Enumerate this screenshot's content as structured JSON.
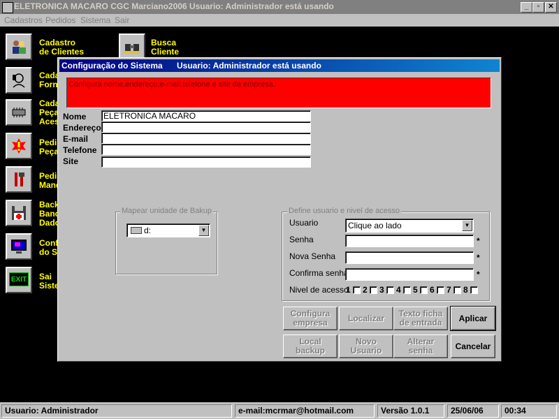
{
  "window": {
    "title": "ELETRONICA MACARO    CGC Marciano2006    Usuario: Administrador  está usando",
    "minimize_glyph": "_",
    "restore_glyph": "▫",
    "close_glyph": "✕"
  },
  "menu": [
    "Cadastros",
    "Pedidos",
    "Sistema",
    "Sair"
  ],
  "desktop_icons": [
    {
      "label": "Cadastro\nde Clientes",
      "icon": "people-icon"
    },
    {
      "label": "Busca\nCliente",
      "icon": "binoculars-icon"
    },
    {
      "label": "Cada\nForn",
      "icon": "phone-person-icon"
    },
    {
      "label": "Cada\nPeça\nAces",
      "icon": "chip-icon"
    },
    {
      "label": "Pedi\nPeça",
      "icon": "alert-icon"
    },
    {
      "label": "Pedi\nMand",
      "icon": "tools-icon"
    },
    {
      "label": "Back\nBanc\nDado",
      "icon": "floppy-icon"
    },
    {
      "label": "Conf\ndo S",
      "icon": "monitor-icon"
    },
    {
      "label": "Sai\nSiste",
      "icon": "exit-icon"
    }
  ],
  "exit_icon_text": "EXIT",
  "dialog": {
    "title": "Configuração do Sistema",
    "title_user": "Usuario: Administrador  está usando",
    "info_text": "Configura  nome,endereço,e-mail,telefone e site da empresa.",
    "fields": [
      {
        "label": "Nome",
        "value": "ELETRONICA MACARO"
      },
      {
        "label": "Endereço",
        "value": ""
      },
      {
        "label": "E-mail",
        "value": ""
      },
      {
        "label": "Telefone",
        "value": ""
      },
      {
        "label": "Site",
        "value": ""
      }
    ],
    "backup_group": {
      "title": "Mapear unidade de Bakup",
      "drive_value": "d:"
    },
    "user_group": {
      "title": "Define usuario e nivel de acesso",
      "usuario_label": "Usuario",
      "usuario_value": "Clique ao lado",
      "senha_label": "Senha",
      "nova_senha_label": "Nova Senha",
      "confirma_label": "Confirma senha",
      "nivel_label": "Nivel de acesso",
      "levels": [
        "1",
        "2",
        "3",
        "4",
        "5",
        "6",
        "7",
        "8"
      ],
      "required_mark": "*"
    },
    "buttons": [
      {
        "label": "Configura\nempresa",
        "enabled": false
      },
      {
        "label": "Localizar",
        "enabled": false
      },
      {
        "label": "Texto ficha\nde entrada",
        "enabled": false
      },
      {
        "label": "Aplicar",
        "enabled": true
      },
      {
        "label": "Local\nbackup",
        "enabled": false
      },
      {
        "label": "Novo\nUsuario",
        "enabled": false
      },
      {
        "label": "Alterar\nsenha",
        "enabled": false
      },
      {
        "label": "Cancelar",
        "enabled": true
      }
    ]
  },
  "status": {
    "user": "Usuario: Administrador",
    "email": "e-mail:mcrmar@hotmail.com",
    "version": "Versão 1.0.1",
    "date": "25/06/06",
    "time": "00:34"
  }
}
